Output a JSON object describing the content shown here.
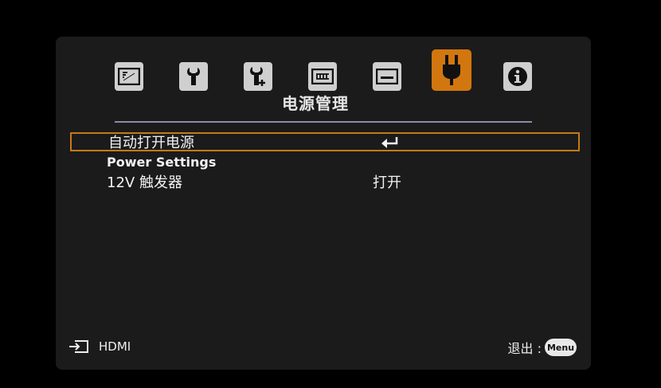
{
  "tabs": [
    {
      "icon": "picture-icon",
      "active": false
    },
    {
      "icon": "wrench-icon",
      "active": false
    },
    {
      "icon": "wrench-plus-icon",
      "active": false
    },
    {
      "icon": "display-icon",
      "active": false
    },
    {
      "icon": "screen-icon",
      "active": false
    },
    {
      "icon": "power-plug-icon",
      "active": true
    },
    {
      "icon": "info-icon",
      "active": false
    }
  ],
  "menu_title": "电源管理",
  "rows": [
    {
      "label": "自动打开电源",
      "value_icon": "enter-icon",
      "selected": true
    },
    {
      "label": "Power Settings",
      "value": ""
    },
    {
      "label": "12V 触发器",
      "value": "打开"
    }
  ],
  "footer": {
    "source_icon": "input-source-icon",
    "source_label": "HDMI",
    "exit_label": "退出 :",
    "menu_button_label": "Menu"
  },
  "colors": {
    "accent": "#d2770f",
    "selection_border": "#c57a17",
    "panel_bg": "#1b1b1b",
    "tab_bg": "#cfcfcf",
    "rule": "#8c8ca8"
  }
}
